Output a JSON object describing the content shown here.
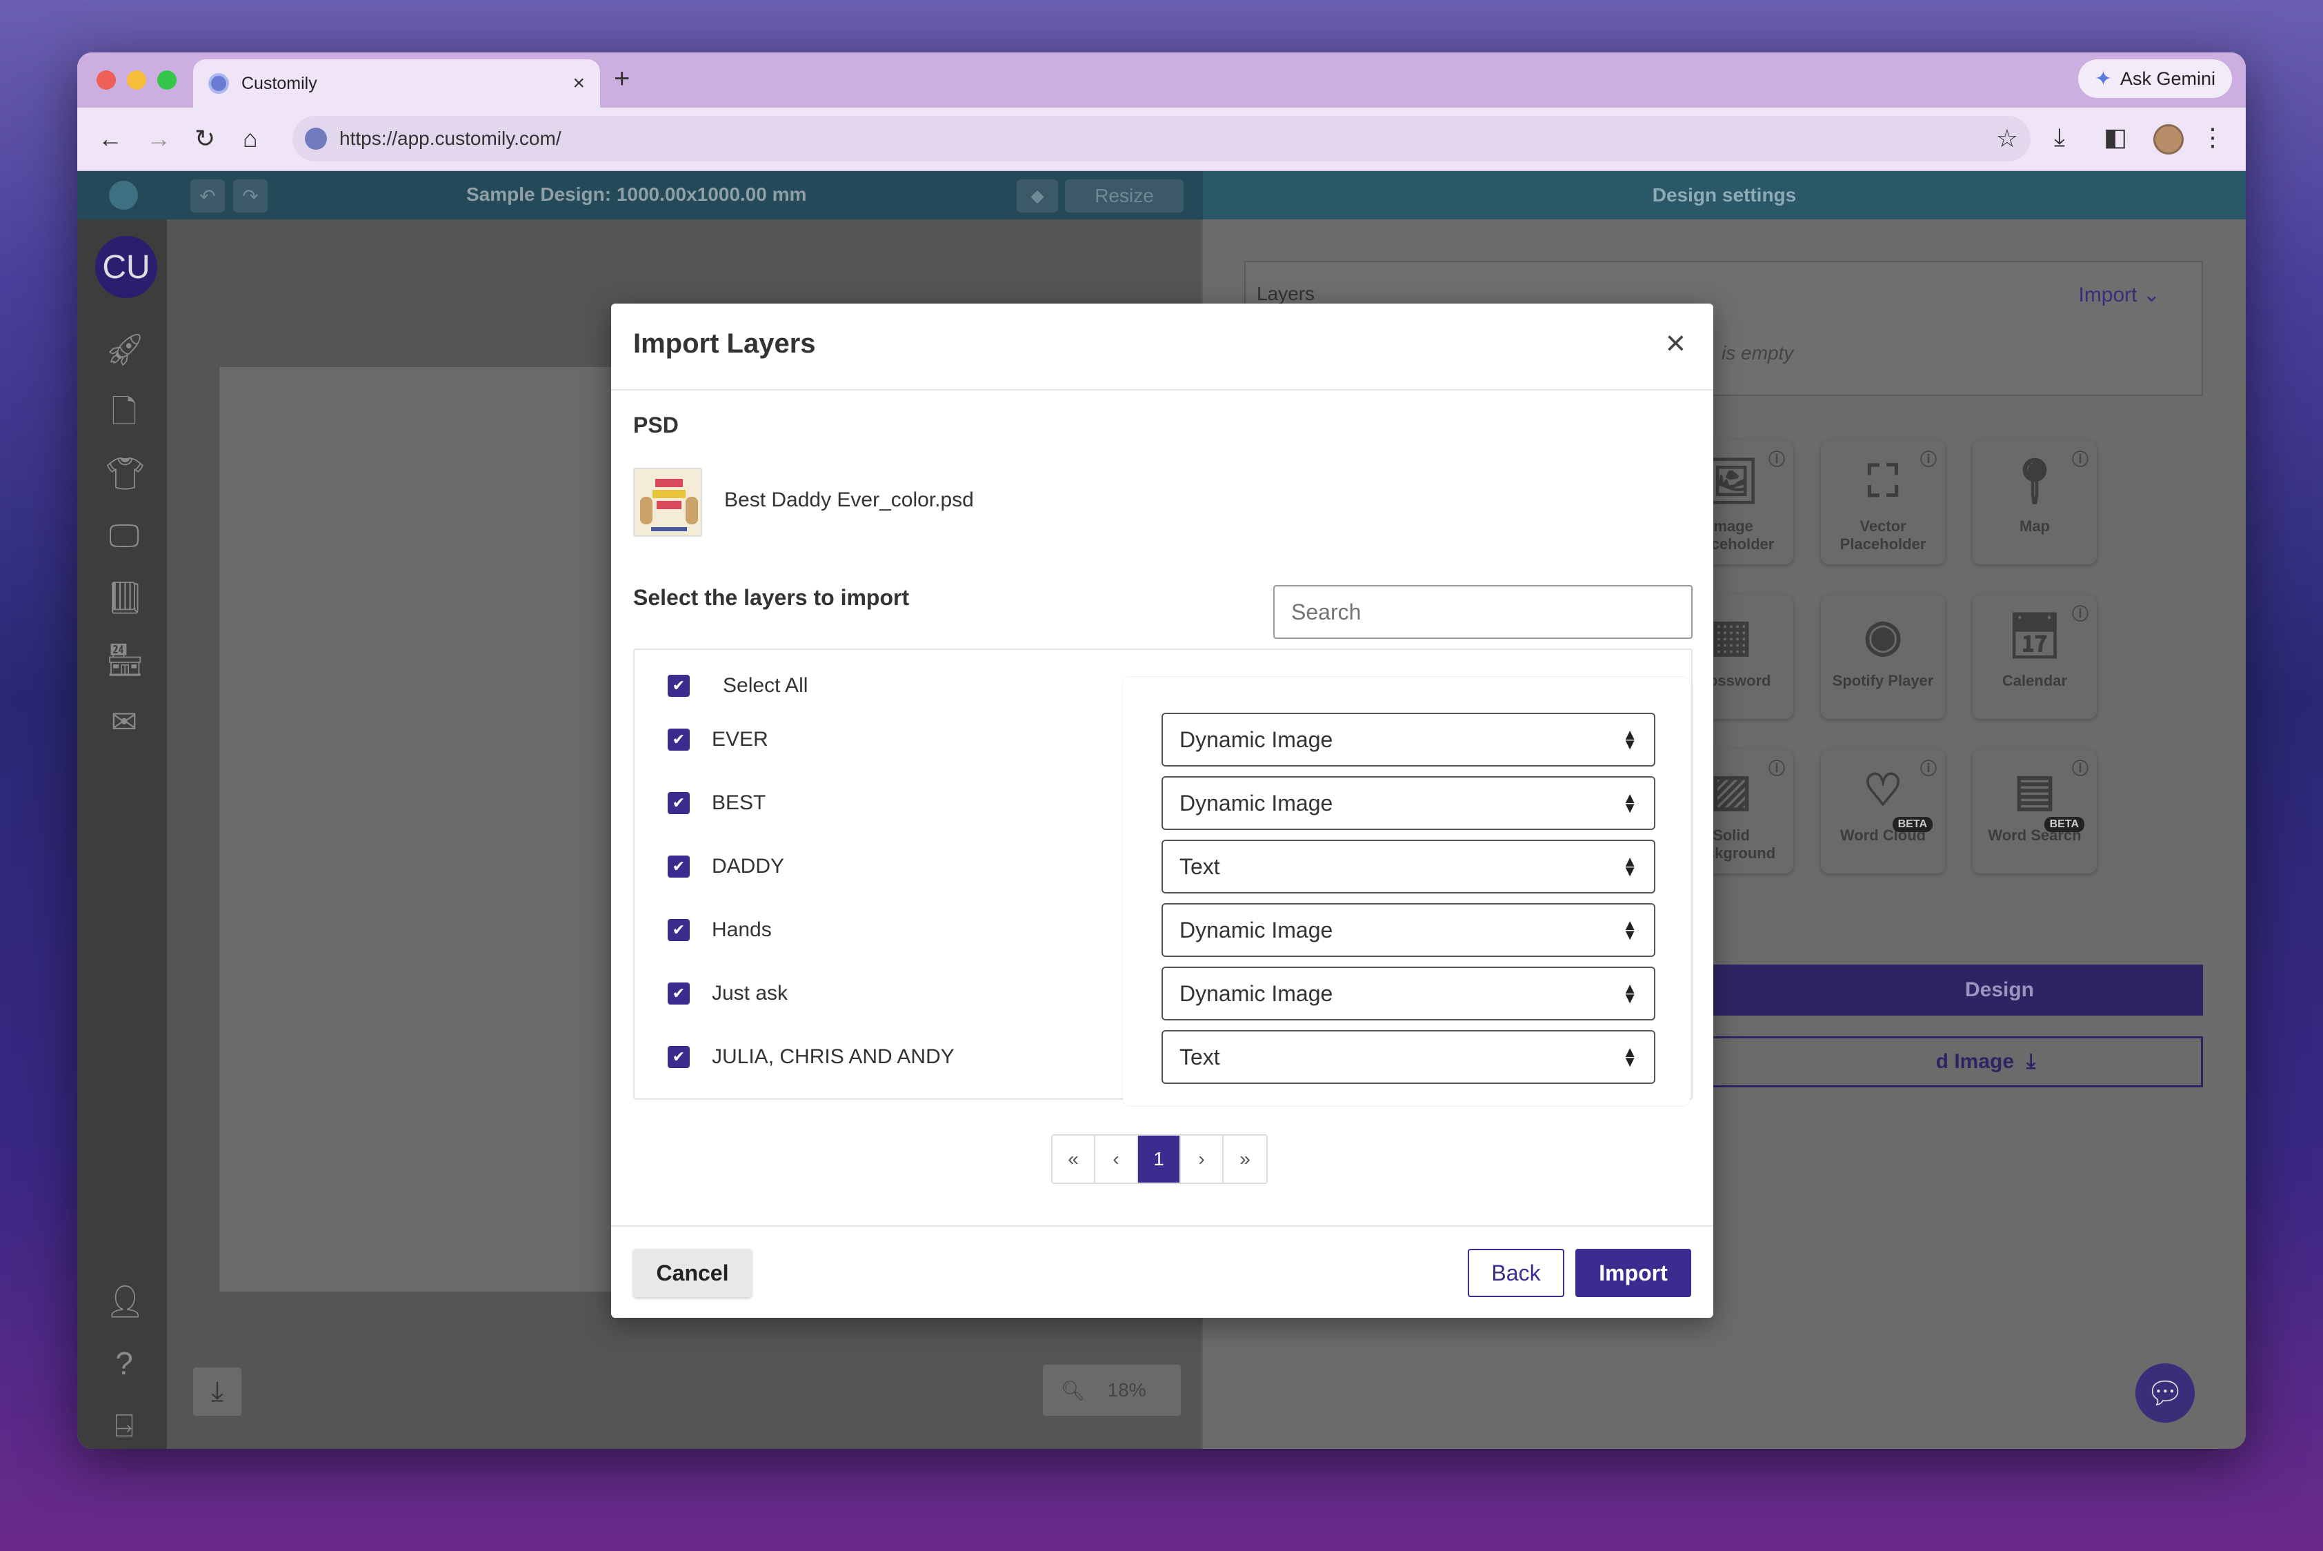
{
  "browser": {
    "tab_title": "Customily",
    "tab_close": "×",
    "new_tab": "+",
    "ask_gemini": "Ask Gemini",
    "url": "https://app.customily.com/"
  },
  "app": {
    "design_title": "Sample Design: 1000.00x1000.00 mm",
    "resize_label": "Resize",
    "settings_title": "Design settings",
    "user_initials": "CU",
    "layers_label": "Layers",
    "layers_import": "Import",
    "layers_empty": "is empty",
    "zoom_level": "18%",
    "tools": [
      {
        "label": "Image Placeholder",
        "icon": "image-icon"
      },
      {
        "label": "Vector Placeholder",
        "icon": "vector-icon"
      },
      {
        "label": "Map",
        "icon": "map-pin-icon"
      },
      {
        "label": "Crossword",
        "icon": "crossword-icon"
      },
      {
        "label": "Spotify Player",
        "icon": "spotify-icon"
      },
      {
        "label": "Calendar",
        "icon": "calendar-icon"
      },
      {
        "label": "Solid Background",
        "icon": "solid-background-icon"
      },
      {
        "label": "Word Cloud",
        "icon": "word-cloud-icon",
        "badge": "BETA"
      },
      {
        "label": "Word Search",
        "icon": "word-search-icon",
        "badge": "BETA"
      }
    ],
    "design_button": "Design",
    "image_button": "d Image"
  },
  "modal": {
    "title": "Import Layers",
    "close": "×",
    "section_psd": "PSD",
    "file_name": "Best Daddy Ever_color.psd",
    "select_title": "Select the layers to import",
    "search_placeholder": "Search",
    "select_all": "Select All",
    "layers": [
      {
        "name": "EVER",
        "type": "Dynamic Image"
      },
      {
        "name": "BEST",
        "type": "Dynamic Image"
      },
      {
        "name": "DADDY",
        "type": "Text"
      },
      {
        "name": "Hands",
        "type": "Dynamic Image"
      },
      {
        "name": "Just ask",
        "type": "Dynamic Image"
      },
      {
        "name": "JULIA, CHRIS AND ANDY",
        "type": "Text"
      }
    ],
    "pager": {
      "first": "«",
      "prev": "‹",
      "current": "1",
      "next": "›",
      "last": "»"
    },
    "cancel": "Cancel",
    "back": "Back",
    "import": "Import"
  },
  "colors": {
    "accent": "#3a2d8f",
    "header": "#244a5a"
  }
}
